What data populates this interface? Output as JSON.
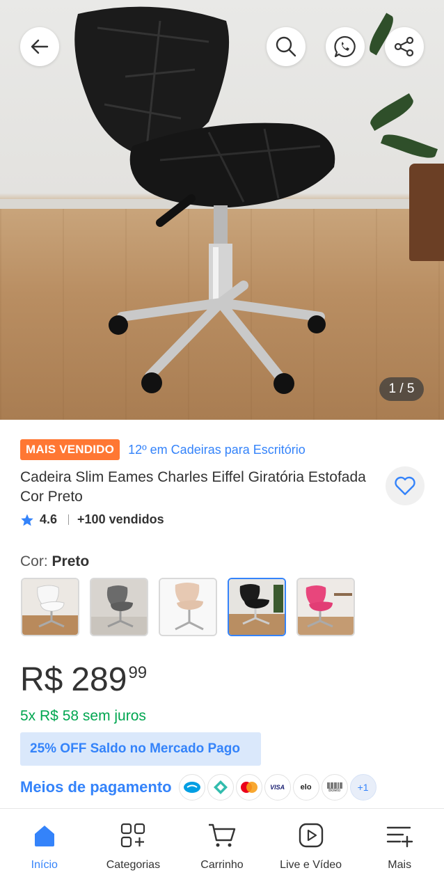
{
  "gallery": {
    "counter": "1 / 5"
  },
  "product": {
    "badge": "MAIS VENDIDO",
    "ranking": "12º em Cadeiras para Escritório",
    "title": "Cadeira Slim Eames Charles Eiffel Giratória Estofada Cor Preto",
    "rating": "4.6",
    "sold": "+100 vendidos"
  },
  "variation": {
    "label": "Cor:",
    "value": "Preto",
    "options": [
      "Branco",
      "Cinza",
      "Nude",
      "Preto",
      "Rosa"
    ],
    "selected_index": 3
  },
  "pricing": {
    "currency": "R$",
    "integer": "289",
    "cents": "99",
    "installments": "5x R$ 58 sem juros",
    "promo": "25% OFF Saldo no Mercado Pago",
    "payment_methods_label": "Meios de pagamento",
    "payment_icons": [
      "mercado-pago",
      "pix",
      "mastercard",
      "visa",
      "elo",
      "boleto"
    ],
    "visa_text": "VISA",
    "elo_text": "elo",
    "boleto_text": "Boleto",
    "more": "+1"
  },
  "bottom_nav": {
    "home": "Início",
    "categories": "Categorias",
    "cart": "Carrinho",
    "live": "Live e Vídeo",
    "more": "Mais"
  },
  "colors": {
    "accent": "#3483fa",
    "badge": "#ff7733",
    "success": "#00a650"
  }
}
